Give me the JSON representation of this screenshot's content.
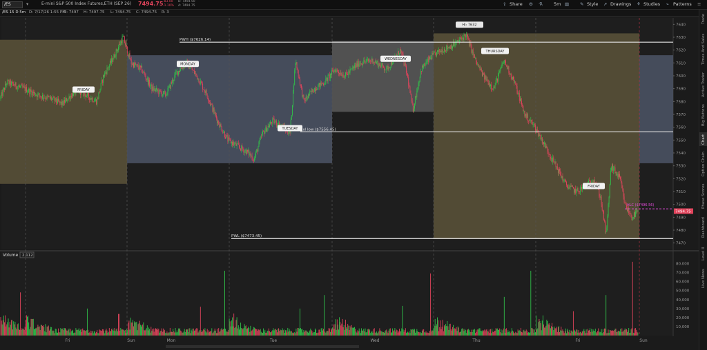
{
  "toolbar": {
    "symbol": "/ES",
    "description": "E-mini S&P 500 Index Futures,ETH (SEP 26)",
    "last_price": "7494.75",
    "change": "-83.00",
    "change_pct": "-1.10%",
    "bid": "B: 7494.50",
    "ask": "A: 7494.75",
    "share": "Share",
    "interval": "5m",
    "style": "Style",
    "drawings": "Drawings",
    "studies": "Studies",
    "patterns": "Patterns"
  },
  "subbar": {
    "symbol_interval": "/ES 15 D 5m",
    "date": "D: 7/17/26 1:55 PM",
    "open": "O: 7497",
    "high": "H: 7497.75",
    "low": "L: 7494.75",
    "close": "C: 7494.75",
    "range": "R: 3"
  },
  "right_tabs": [
    "Trade",
    "Times And Sales",
    "Active Trader",
    "Big Buttons",
    "Chart",
    "Option Chain",
    "Phase Scores",
    "Dashboard",
    "Level II",
    "Live News"
  ],
  "active_tab": "Chart",
  "colors": {
    "up": "#31c24a",
    "down": "#e2445c",
    "friday_box": "#5c5439",
    "monday_box": "#4c5566",
    "tuesday_box": "#4c5566",
    "wednesday_box": "#5a5a5a",
    "thursday_box": "#5c5439",
    "pwh_line": "#e8e8e8",
    "gxl_line": "#e8e8e8",
    "close_line": "#e04ad8"
  },
  "chart_data": {
    "type": "candlestick",
    "price_axis": {
      "ylim": [
        7465,
        7645
      ],
      "ticks": [
        7470,
        7480,
        7490,
        7500,
        7510,
        7520,
        7530,
        7540,
        7550,
        7560,
        7570,
        7580,
        7590,
        7600,
        7610,
        7620,
        7630,
        7640
      ]
    },
    "volume_axis": {
      "ylim": [
        0,
        85000
      ],
      "ticks": [
        "10,000",
        "20,000",
        "30,000",
        "40,000",
        "50,000",
        "60,000",
        "70,000",
        "80,000"
      ]
    },
    "volume_label": "Volume",
    "volume_value": "2,112",
    "x_ticks": [
      "Fri",
      "Sun",
      "Mon",
      "Tue",
      "Wed",
      "Thu",
      "Fri",
      "Sun"
    ],
    "path": [
      [
        0,
        7582
      ],
      [
        10,
        7595
      ],
      [
        35,
        7590
      ],
      [
        55,
        7585
      ],
      [
        75,
        7582
      ],
      [
        90,
        7578
      ],
      [
        105,
        7586
      ],
      [
        115,
        7588
      ],
      [
        125,
        7585
      ],
      [
        140,
        7580
      ],
      [
        150,
        7600
      ],
      [
        165,
        7615
      ],
      [
        178,
        7630
      ],
      [
        190,
        7610
      ],
      [
        205,
        7605
      ],
      [
        220,
        7590
      ],
      [
        240,
        7585
      ],
      [
        255,
        7602
      ],
      [
        270,
        7610
      ],
      [
        285,
        7600
      ],
      [
        300,
        7585
      ],
      [
        315,
        7565
      ],
      [
        330,
        7550
      ],
      [
        345,
        7545
      ],
      [
        360,
        7540
      ],
      [
        368,
        7535
      ],
      [
        380,
        7555
      ],
      [
        395,
        7565
      ],
      [
        410,
        7560
      ],
      [
        420,
        7555
      ],
      [
        428,
        7612
      ],
      [
        440,
        7580
      ],
      [
        455,
        7590
      ],
      [
        470,
        7595
      ],
      [
        485,
        7605
      ],
      [
        500,
        7600
      ],
      [
        520,
        7610
      ],
      [
        540,
        7612
      ],
      [
        560,
        7605
      ],
      [
        580,
        7620
      ],
      [
        590,
        7600
      ],
      [
        598,
        7573
      ],
      [
        610,
        7605
      ],
      [
        625,
        7615
      ],
      [
        640,
        7620
      ],
      [
        660,
        7625
      ],
      [
        675,
        7632
      ],
      [
        690,
        7610
      ],
      [
        700,
        7600
      ],
      [
        715,
        7590
      ],
      [
        730,
        7612
      ],
      [
        745,
        7595
      ],
      [
        760,
        7570
      ],
      [
        775,
        7560
      ],
      [
        790,
        7545
      ],
      [
        805,
        7530
      ],
      [
        820,
        7515
      ],
      [
        835,
        7510
      ],
      [
        850,
        7515
      ],
      [
        860,
        7520
      ],
      [
        870,
        7505
      ],
      [
        878,
        7475
      ],
      [
        885,
        7530
      ],
      [
        898,
        7520
      ],
      [
        905,
        7500
      ],
      [
        915,
        7490
      ],
      [
        925,
        7495
      ]
    ],
    "day_boxes": [
      {
        "label": "FRIDAY",
        "x0": 0,
        "x1": 184,
        "y_top": 7628,
        "y_bottom": 7516,
        "color_key": "friday_box"
      },
      {
        "label": "MONDAY",
        "x0": 184,
        "x1": 481,
        "y_top": 7616,
        "y_bottom": 7532,
        "color_key": "monday_box"
      },
      {
        "label": "TUESDAY",
        "x0": 184,
        "x1": 481,
        "y_top": 7616,
        "y_bottom": 7532,
        "color_key": "tuesday_box"
      },
      {
        "label": "WEDNESDAY",
        "x0": 481,
        "x1": 628,
        "y_top": 7627,
        "y_bottom": 7572,
        "color_key": "wednesday_box"
      },
      {
        "label": "THURSDAY",
        "x0": 628,
        "x1": 926,
        "y_top": 7633,
        "y_bottom": 7473,
        "color_key": "thursday_box"
      }
    ],
    "levels": [
      {
        "label": "PWH ($7626.14)",
        "value": 7626.14,
        "x0": 260
      },
      {
        "label": "gxl low ($7556.45)",
        "value": 7556.45,
        "x0": 435
      },
      {
        "label": "PWL ($7473.45)",
        "value": 7473.45,
        "x0": 335
      }
    ],
    "hi_label": "Hi: 7632",
    "close_marker": {
      "label": "HLC ($7496.56)",
      "value": 7496.56
    },
    "last_price_tag": "7494.75",
    "day_labels": [
      {
        "text": "FRIDAY",
        "x": 121,
        "price": 7589
      },
      {
        "text": "MONDAY",
        "x": 272,
        "price": 7609
      },
      {
        "text": "TUESDAY",
        "x": 420,
        "price": 7559
      },
      {
        "text": "WEDNESDAY",
        "x": 573,
        "price": 7613
      },
      {
        "text": "THURSDAY",
        "x": 717,
        "price": 7619
      },
      {
        "text": "FRIDAY",
        "x": 860,
        "price": 7514
      }
    ]
  }
}
